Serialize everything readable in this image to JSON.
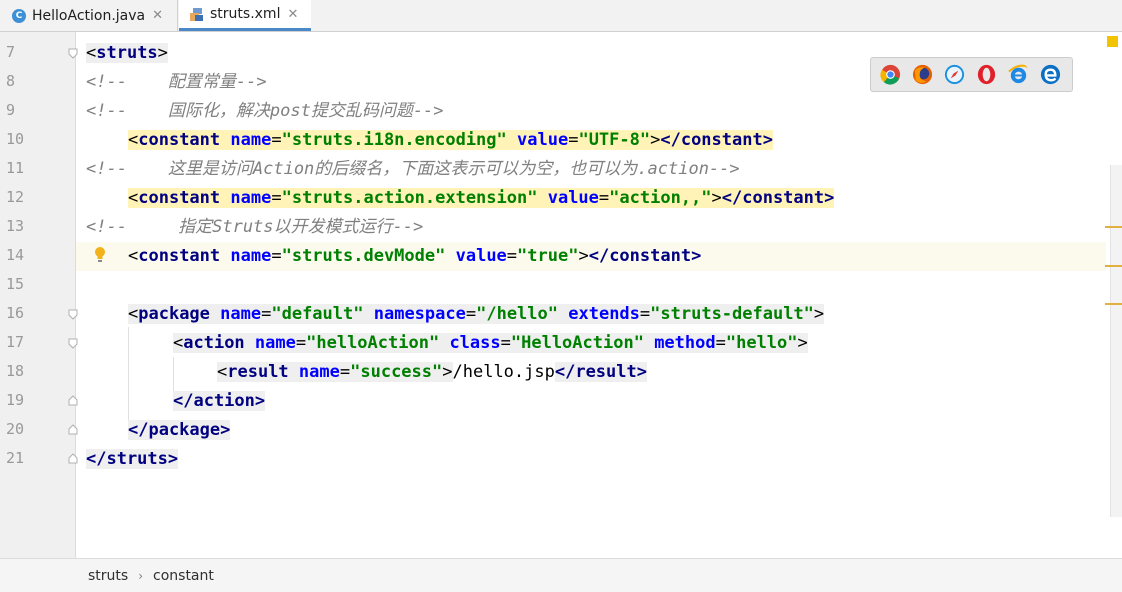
{
  "tabs": [
    {
      "label": "HelloAction.java",
      "icon": "java-class-icon",
      "active": false
    },
    {
      "label": "struts.xml",
      "icon": "xml-file-icon",
      "active": true
    }
  ],
  "gutter": {
    "line_numbers": [
      "7",
      "8",
      "9",
      "10",
      "11",
      "12",
      "13",
      "14",
      "15",
      "16",
      "17",
      "18",
      "19",
      "20",
      "21"
    ]
  },
  "code": {
    "l7": {
      "open": "<",
      "tag": "struts",
      "close": ">"
    },
    "l8": {
      "comment": "<!--    配置常量-->"
    },
    "l9": {
      "comment": "<!--    国际化，解决post提交乱码问题-->"
    },
    "l10": {
      "lt": "<",
      "tag": "constant",
      "a1": "name",
      "eq": "=",
      "v1": "\"struts.i18n.encoding\"",
      "a2": "value",
      "v2": "\"UTF-8\"",
      "gt": ">",
      "end": "</constant>"
    },
    "l11": {
      "comment": "<!--    这里是访问Action的后缀名，下面这表示可以为空，也可以为.action-->"
    },
    "l12": {
      "lt": "<",
      "tag": "constant",
      "a1": "name",
      "v1": "\"struts.action.extension\"",
      "a2": "value",
      "v2": "\"action,,\"",
      "gt": ">",
      "end": "</constant>"
    },
    "l13": {
      "comment": "<!--     指定Struts以开发模式运行-->"
    },
    "l14": {
      "lt": "<",
      "tag": "constant",
      "a1": "name",
      "v1": "\"struts.devMode\"",
      "a2": "value",
      "v2": "\"true\"",
      "gt": ">",
      "end": "</constant>"
    },
    "l16": {
      "lt": "<",
      "tag": "package",
      "a1": "name",
      "v1": "\"default\"",
      "a2": "namespace",
      "v2": "\"/hello\"",
      "a3": "extends",
      "v3": "\"struts-default\"",
      "gt": ">"
    },
    "l17": {
      "lt": "<",
      "tag": "action",
      "a1": "name",
      "v1": "\"helloAction\"",
      "a2": "class",
      "v2": "\"HelloAction\"",
      "a3": "method",
      "v3": "\"hello\"",
      "gt": ">"
    },
    "l18": {
      "lt": "<",
      "tag": "result",
      "a1": "name",
      "v1": "\"success\"",
      "gt": ">",
      "text": "/hello.jsp",
      "end": "</result>"
    },
    "l19": {
      "end": "</action>"
    },
    "l20": {
      "end": "</package>"
    },
    "l21": {
      "end": "</struts>"
    }
  },
  "browsers": [
    "chrome-icon",
    "firefox-icon",
    "safari-icon",
    "opera-icon",
    "ie-icon",
    "edge-icon"
  ],
  "breadcrumb": [
    "struts",
    "constant"
  ],
  "colors": {
    "tag": "#000080",
    "attr": "#0000ff",
    "value": "#008000",
    "comment": "#808080",
    "tab_accent": "#4a88c7"
  }
}
